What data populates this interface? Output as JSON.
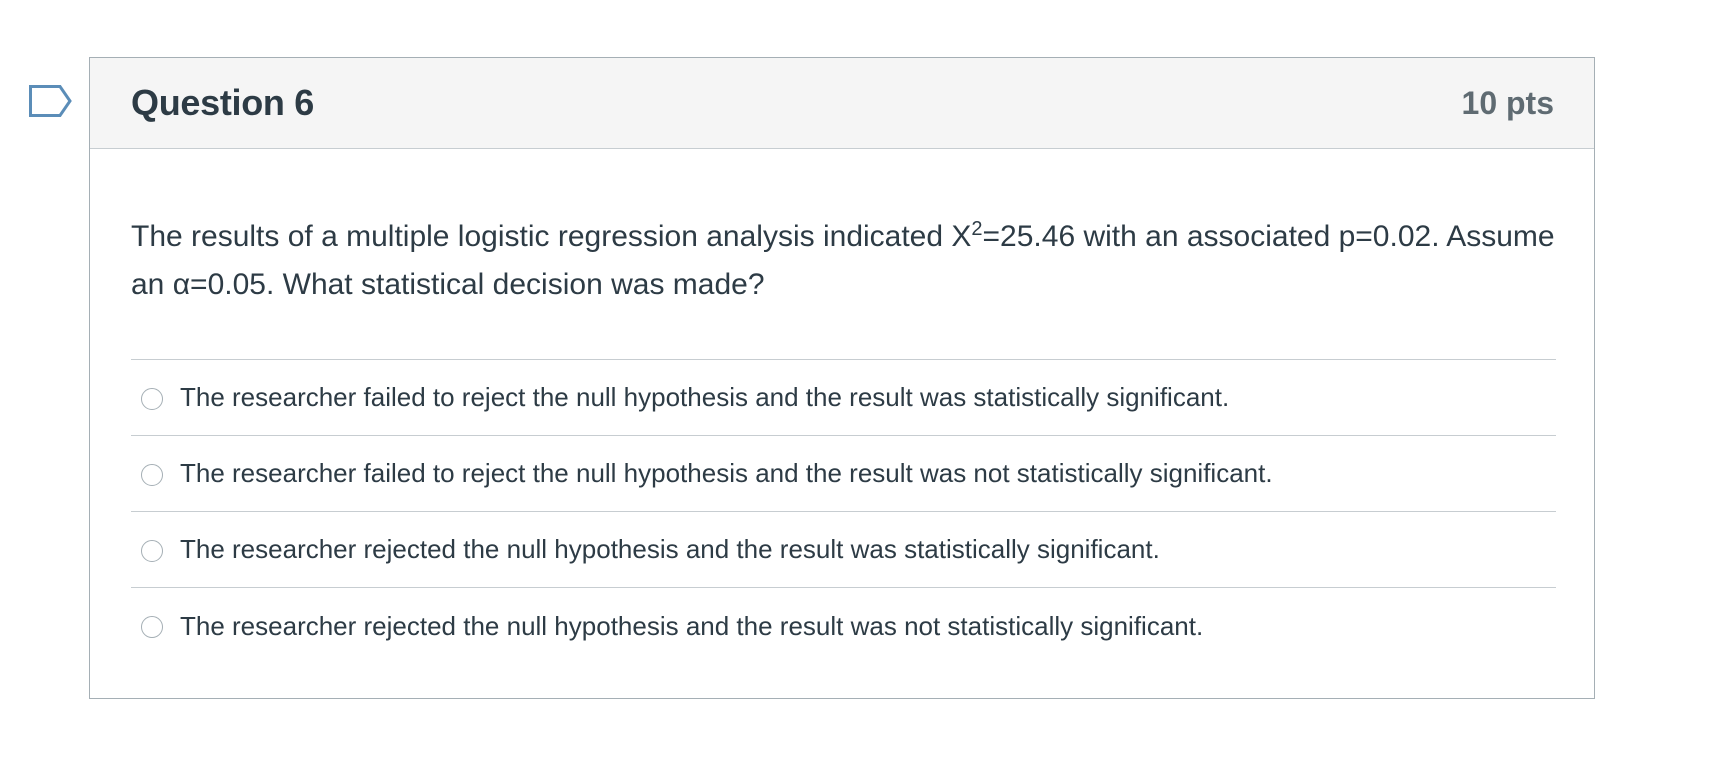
{
  "question": {
    "title": "Question 6",
    "points": "10 pts",
    "text_before_sup": "The results of a multiple logistic regression analysis indicated X",
    "sup": "2",
    "text_after_sup": "=25.46 with an associated p=0.02. Assume an α=0.05. What statistical decision was made?"
  },
  "flag": {
    "icon": "bookmark-flag-icon",
    "color": "#5b8db8"
  },
  "answers": [
    {
      "label": "The researcher failed to reject the null hypothesis and the result was statistically significant.",
      "selected": false
    },
    {
      "label": "The researcher failed to reject the null hypothesis and the result was not statistically significant.",
      "selected": false
    },
    {
      "label": "The researcher rejected the null hypothesis and the result was statistically significant.",
      "selected": false
    },
    {
      "label": "The researcher rejected the null hypothesis and the result was not statistically significant.",
      "selected": false
    }
  ],
  "colors": {
    "text": "#2d3b45",
    "muted": "#5f6b72",
    "border": "#c7cdd1",
    "header_bg": "#f5f5f5"
  }
}
